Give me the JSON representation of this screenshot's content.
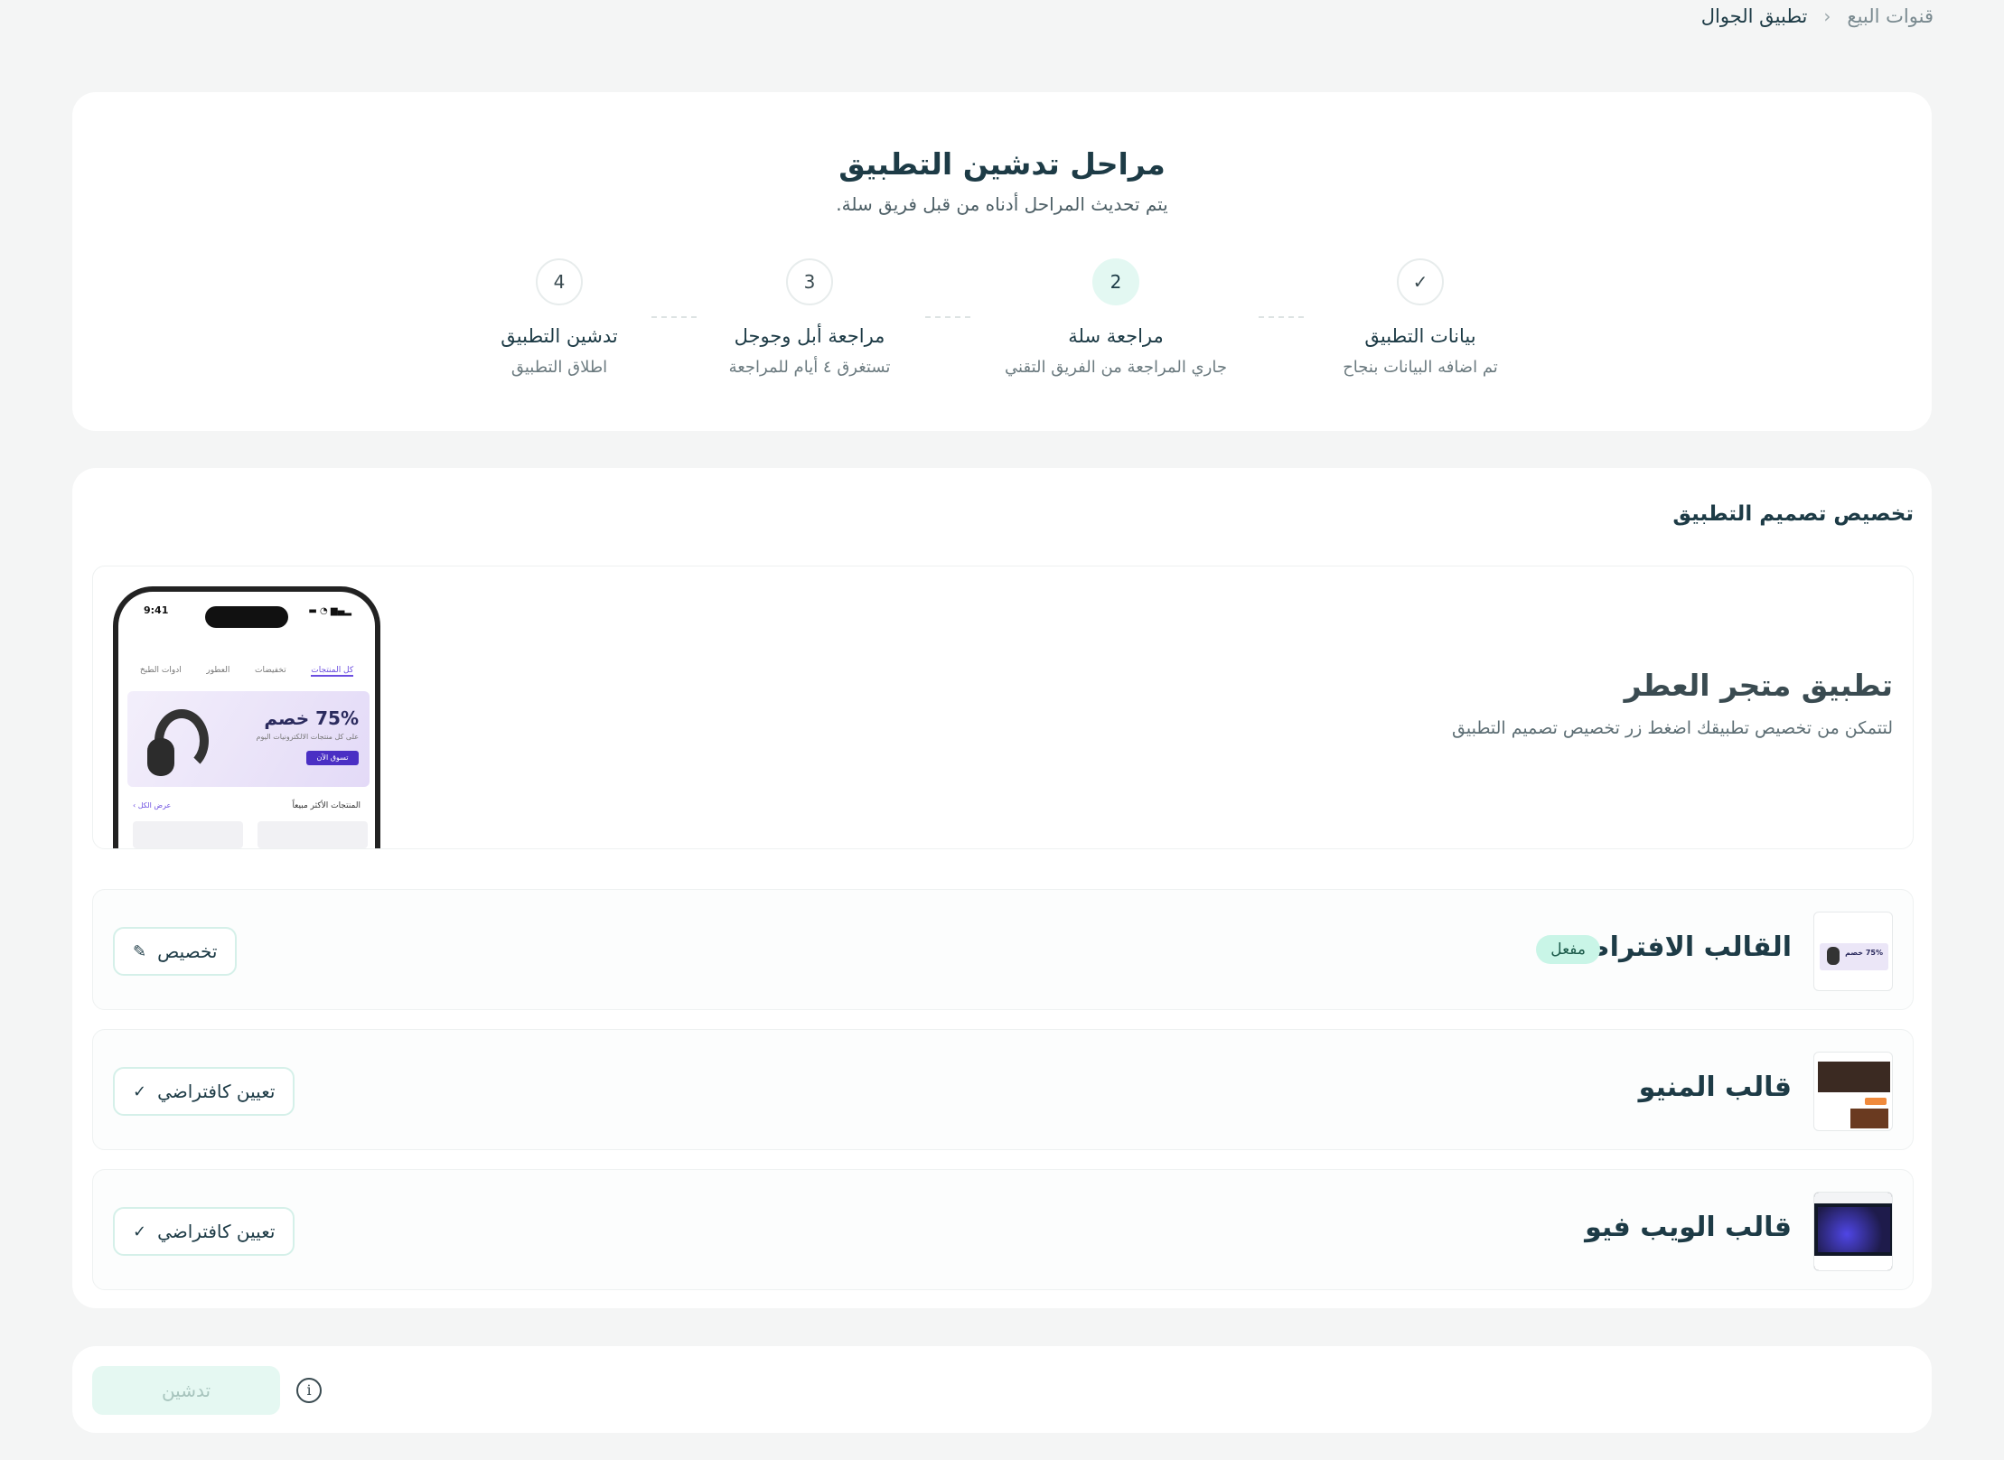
{
  "breadcrumb": {
    "parent": "قنوات البيع",
    "separator": "‹",
    "current": "تطبيق الجوال"
  },
  "stages": {
    "title": "مراحل تدشين التطبيق",
    "subtitle": "يتم تحديث المراحل أدناه من قبل فريق سلة.",
    "steps": [
      {
        "marker": "✓",
        "title": "بيانات التطبيق",
        "subtitle": "تم اضافه البيانات بنجاح",
        "state": "done"
      },
      {
        "marker": "2",
        "title": "مراجعة سلة",
        "subtitle": "جاري المراجعة من الفريق التقني",
        "state": "active"
      },
      {
        "marker": "3",
        "title": "مراجعة أبل وجوجل",
        "subtitle": "تستغرق ٤ أيام للمراجعة",
        "state": "pending"
      },
      {
        "marker": "4",
        "title": "تدشين التطبيق",
        "subtitle": "اطلاق التطبيق",
        "state": "pending"
      }
    ]
  },
  "design": {
    "heading": "تخصيص تصميم التطبيق",
    "hero": {
      "title": "تطبيق متجر العطر",
      "description": "لتتمكن من تخصيص تطبيقك اضغط زر تخصيص تصميم التطبيق"
    },
    "phone_preview": {
      "time": "9:41",
      "status": "▂▄▆ ◔ ▬",
      "tabs": [
        "كل المنتجات",
        "تخفيضات",
        "العطور",
        "ادوات الطبخ"
      ],
      "discount": "75% خصم",
      "discount_sub": "على كل منتجات الالكترونيات اليوم",
      "shop_now": "تسوق الآن",
      "best_sellers": "المنتجات الأكثر مبيعاً",
      "view_all": "عرض الكل ›"
    },
    "templates": [
      {
        "name": "القالب الافتراضي",
        "badge": "مفعل",
        "button_label": "تخصيص",
        "button_icon": "pencil-icon",
        "icon_glyph": "✎"
      },
      {
        "name": "قالب المنيو",
        "badge": "",
        "button_label": "تعيين كافتراضي",
        "button_icon": "check-icon",
        "icon_glyph": "✓"
      },
      {
        "name": "قالب الويب فيو",
        "badge": "",
        "button_label": "تعيين كافتراضي",
        "button_icon": "check-icon",
        "icon_glyph": "✓"
      }
    ]
  },
  "launch": {
    "button_label": "تدشين",
    "info_glyph": "i"
  },
  "colors": {
    "primary_dark": "#1d3b46",
    "accent_mint": "#c9f5e7",
    "active_step_bg": "#e3f8f2",
    "disabled_button_bg": "#e5f8f2",
    "page_bg": "#f4f5f5"
  }
}
